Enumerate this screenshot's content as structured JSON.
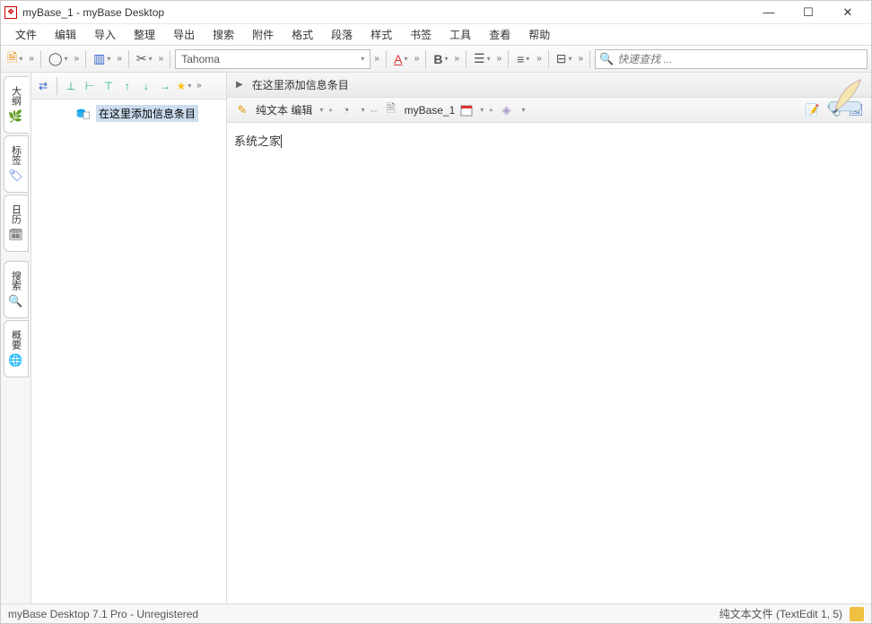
{
  "window": {
    "title": "myBase_1 - myBase Desktop"
  },
  "menu": {
    "items": [
      "文件",
      "编辑",
      "导入",
      "整理",
      "导出",
      "搜索",
      "附件",
      "格式",
      "段落",
      "样式",
      "书签",
      "工具",
      "查看",
      "帮助"
    ]
  },
  "toolbar": {
    "font_name": "Tahoma",
    "search_placeholder": "快速查找 ..."
  },
  "sidebar_tabs": {
    "t0": "大纲",
    "t1": "标签",
    "t2": "日历",
    "t3": "搜索",
    "t4": "概要"
  },
  "tree": {
    "item0_label": "在这里添加信息条目"
  },
  "editor": {
    "header_label": "在这里添加信息条目",
    "mode_label": "纯文本 编辑",
    "link_sep": "--",
    "doc_name": "myBase_1",
    "content": "系统之家"
  },
  "status": {
    "left": "myBase Desktop 7.1 Pro - Unregistered",
    "right": "纯文本文件 (TextEdit 1, 5)"
  }
}
